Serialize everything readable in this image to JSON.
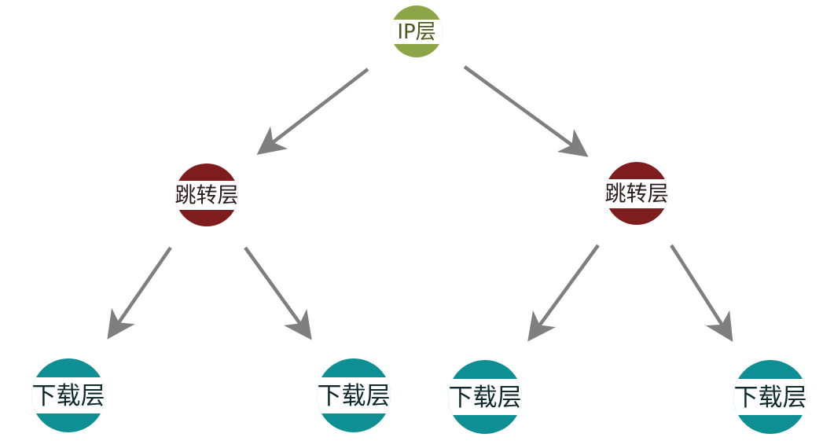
{
  "nodes": {
    "root": {
      "label": "IP层",
      "color": "#8ba547",
      "text_color": "#4a5a1c"
    },
    "mid_left": {
      "label": "跳转层",
      "color": "#7f1c1d",
      "text_color": "#2b1a1a"
    },
    "mid_right": {
      "label": "跳转层",
      "color": "#7f1c1d",
      "text_color": "#2b1a1a"
    },
    "leaf_1": {
      "label": "下载层",
      "color": "#0d8f93",
      "text_color": "#0f2a2c"
    },
    "leaf_2": {
      "label": "下载层",
      "color": "#0d8f93",
      "text_color": "#0f2a2c"
    },
    "leaf_3": {
      "label": "下载层",
      "color": "#0d8f93",
      "text_color": "#0f2a2c"
    },
    "leaf_4": {
      "label": "下载层",
      "color": "#0d8f93",
      "text_color": "#0f2a2c"
    }
  },
  "edges": [
    {
      "from": "IP层",
      "to": "跳转层"
    },
    {
      "from": "IP层",
      "to": "跳转层"
    },
    {
      "from": "跳转层",
      "to": "下载层"
    },
    {
      "from": "跳转层",
      "to": "下载层"
    },
    {
      "from": "跳转层",
      "to": "下载层"
    },
    {
      "from": "跳转层",
      "to": "下载层"
    }
  ],
  "arrow_color": "#7f7f7f",
  "band_color": "#ffffff"
}
